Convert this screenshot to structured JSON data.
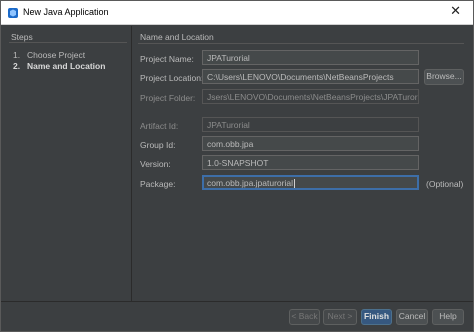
{
  "window": {
    "title": "New Java Application"
  },
  "steps": {
    "heading": "Steps",
    "items": [
      {
        "num": "1.",
        "label": "Choose Project"
      },
      {
        "num": "2.",
        "label": "Name and Location"
      }
    ]
  },
  "main": {
    "heading": "Name and Location",
    "project_name": {
      "label": "Project Name:",
      "value": "JPATurorial"
    },
    "project_location": {
      "label": "Project Location:",
      "value": "C:\\Users\\LENOVO\\Documents\\NetBeansProjects",
      "browse_label": "Browse..."
    },
    "project_folder": {
      "label": "Project Folder:",
      "value": "Jsers\\LENOVO\\Documents\\NetBeansProjects\\JPATurorial"
    },
    "artifact_id": {
      "label": "Artifact Id:",
      "value": "JPATurorial"
    },
    "group_id": {
      "label": "Group Id:",
      "value": "com.obb.jpa"
    },
    "version": {
      "label": "Version:",
      "value": "1.0-SNAPSHOT"
    },
    "package": {
      "label": "Package:",
      "value": "com.obb.jpa.jpaturorial",
      "optional_label": "(Optional)"
    }
  },
  "buttons": {
    "back": "< Back",
    "next": "Next >",
    "finish": "Finish",
    "cancel": "Cancel",
    "help": "Help"
  },
  "colors": {
    "background": "#3c3f41",
    "field": "#45494a",
    "focus": "#3d6ea8",
    "default_button": "#365880",
    "text": "#bbbbbb"
  }
}
